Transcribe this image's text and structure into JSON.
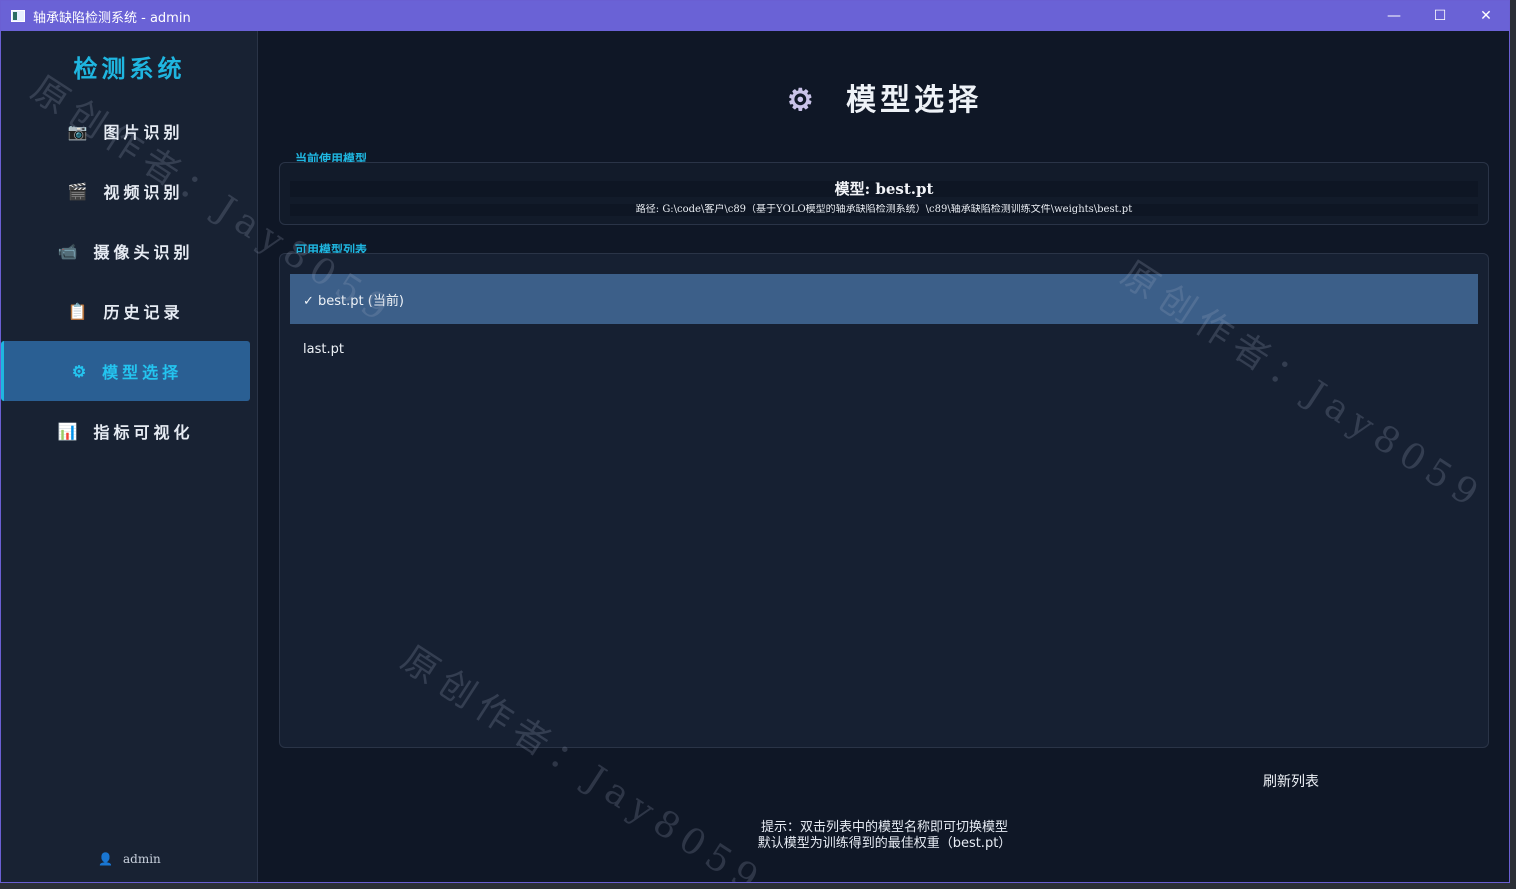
{
  "window": {
    "title": "轴承缺陷检测系统 - admin",
    "minimize": "—",
    "maximize": "☐",
    "close": "✕"
  },
  "sidebar": {
    "brand": "检测系统",
    "items": [
      {
        "icon": "📷",
        "label": "图片识别"
      },
      {
        "icon": "🎬",
        "label": "视频识别"
      },
      {
        "icon": "📹",
        "label": "摄像头识别"
      },
      {
        "icon": "📋",
        "label": "历史记录"
      },
      {
        "icon": "⚙",
        "label": "模型选择"
      },
      {
        "icon": "📊",
        "label": "指标可视化"
      }
    ],
    "active_index": 4,
    "user_icon": "👤",
    "user": "admin"
  },
  "main": {
    "title_icon": "⚙",
    "title": "模型选择",
    "current_section_label": "当前使用模型",
    "current_model": "模型: best.pt",
    "current_path": "路径: G:\\code\\客户\\c89（基于YOLO模型的轴承缺陷检测系统）\\c89\\轴承缺陷检测训练文件\\weights\\best.pt",
    "list_section_label": "可用模型列表",
    "models": [
      "✓ best.pt (当前)",
      "last.pt"
    ],
    "selected_index": 0,
    "refresh_label": "刷新列表",
    "hint_line1": "提示：双击列表中的模型名称即可切换模型",
    "hint_line2": "默认模型为训练得到的最佳权重（best.pt）"
  },
  "watermark": "原创作者：Jay8059"
}
